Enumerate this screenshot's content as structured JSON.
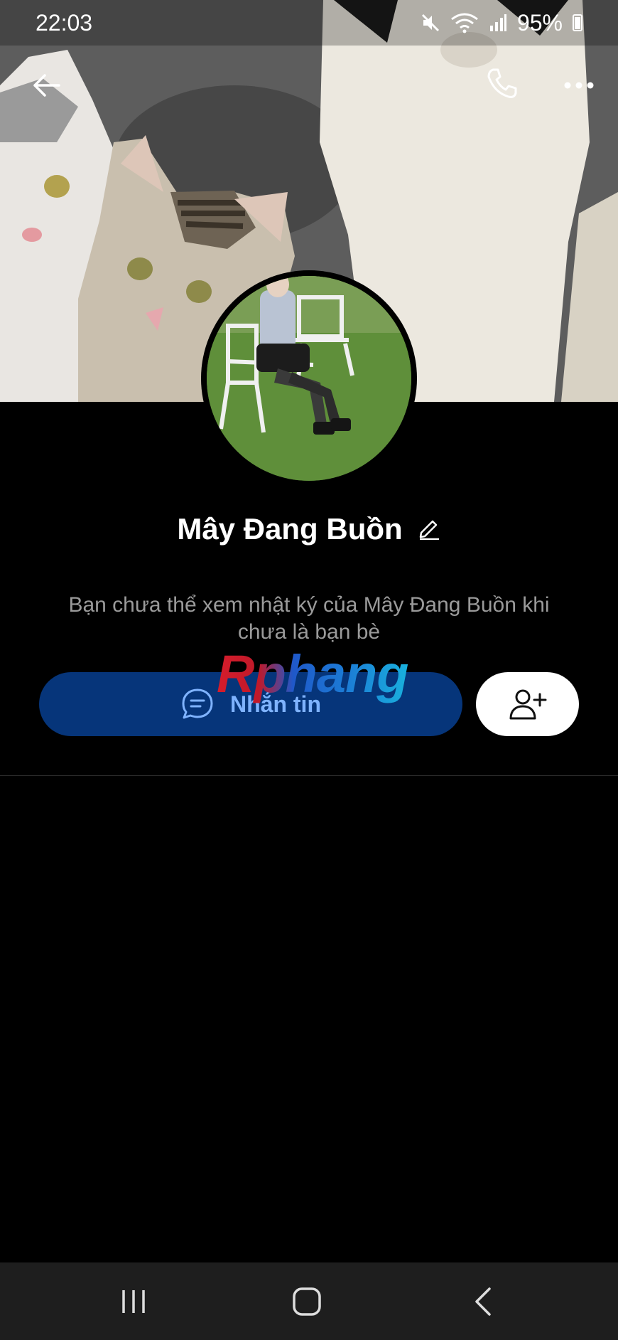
{
  "status_bar": {
    "time": "22:03",
    "battery": "95%",
    "icons": [
      "mute-icon",
      "wifi-icon",
      "signal-icon",
      "battery-icon"
    ]
  },
  "top_bar": {
    "icons": [
      "back-arrow-icon",
      "phone-icon",
      "more-icon"
    ]
  },
  "profile": {
    "name": "Mây Đang Buồn",
    "notice": "Bạn chưa thể xem nhật ký của Mây Đang Buồn khi chưa là bạn bè"
  },
  "watermark": "Rphang",
  "actions": {
    "message_label": "Nhắn tin",
    "message_icon": "chat-bubble-icon",
    "add_friend_icon": "add-user-icon"
  },
  "colors": {
    "message_button_bg": "#06357a",
    "message_button_text": "#7fb3ff"
  },
  "nav_bar": {
    "icons": [
      "recents-icon",
      "home-icon",
      "back-icon"
    ]
  }
}
